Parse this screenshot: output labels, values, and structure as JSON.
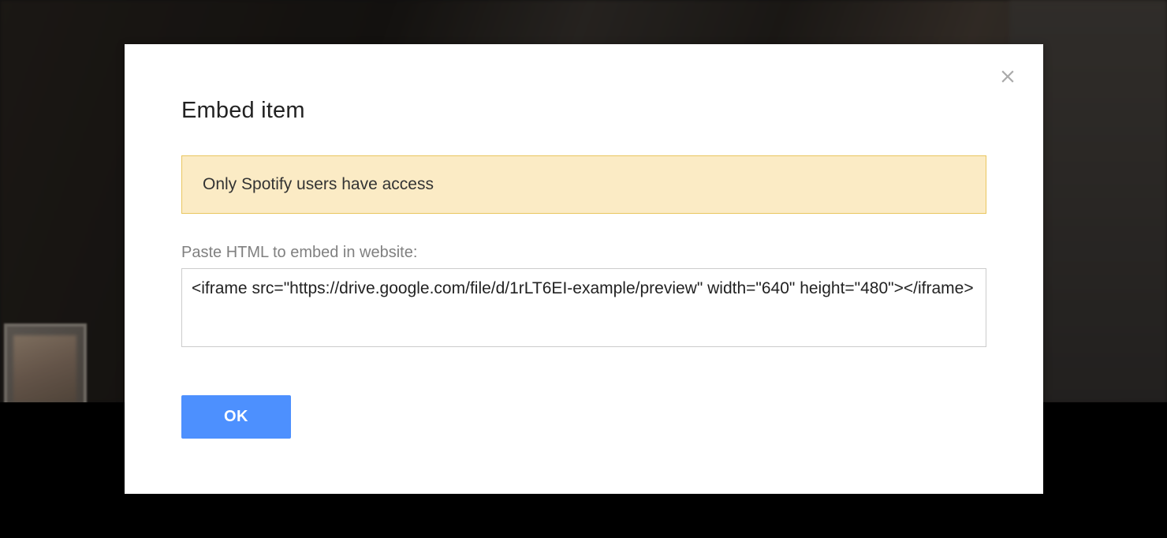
{
  "dialog": {
    "title": "Embed item",
    "notice": "Only Spotify users have access",
    "embed_label": "Paste HTML to embed in website:",
    "embed_code": "<iframe src=\"https://drive.google.com/file/d/1rLT6EI-example/preview\" width=\"640\" height=\"480\"></iframe>",
    "ok_label": "OK"
  }
}
